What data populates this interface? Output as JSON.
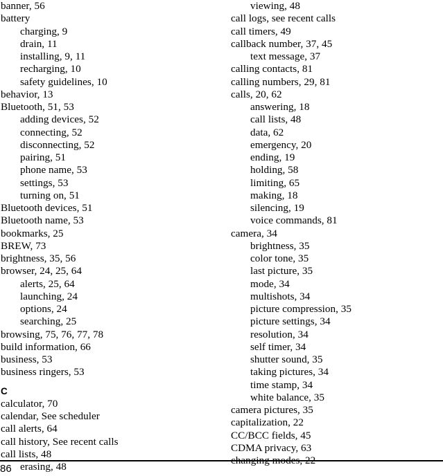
{
  "document": {
    "type": "book-index",
    "page_number": "86",
    "columns": 2,
    "footer_rule": true,
    "text_color": "#000000",
    "background_color": "#ffffff"
  },
  "left_column": [
    {
      "level": 1,
      "text": "banner, 56"
    },
    {
      "level": 1,
      "text": "battery"
    },
    {
      "level": 2,
      "text": "charging, 9"
    },
    {
      "level": 2,
      "text": "drain, 11"
    },
    {
      "level": 2,
      "text": "installing, 9, 11"
    },
    {
      "level": 2,
      "text": "recharging, 10"
    },
    {
      "level": 2,
      "text": "safety guidelines, 10"
    },
    {
      "level": 1,
      "text": "behavior, 13"
    },
    {
      "level": 1,
      "text": "Bluetooth, 51, 53"
    },
    {
      "level": 2,
      "text": "adding devices, 52"
    },
    {
      "level": 2,
      "text": "connecting, 52"
    },
    {
      "level": 2,
      "text": "disconnecting, 52"
    },
    {
      "level": 2,
      "text": "pairing, 51"
    },
    {
      "level": 2,
      "text": "phone name, 53"
    },
    {
      "level": 2,
      "text": "settings, 53"
    },
    {
      "level": 2,
      "text": "turning on, 51"
    },
    {
      "level": 1,
      "text": "Bluetooth devices, 51"
    },
    {
      "level": 1,
      "text": "Bluetooth name, 53"
    },
    {
      "level": 1,
      "text": "bookmarks, 25"
    },
    {
      "level": 1,
      "text": "BREW, 73"
    },
    {
      "level": 1,
      "text": "brightness, 35, 56"
    },
    {
      "level": 1,
      "text": "browser, 24, 25, 64"
    },
    {
      "level": 2,
      "text": "alerts, 25, 64"
    },
    {
      "level": 2,
      "text": "launching, 24"
    },
    {
      "level": 2,
      "text": "options, 24"
    },
    {
      "level": 2,
      "text": "searching, 25"
    },
    {
      "level": 1,
      "text": "browsing, 75, 76, 77, 78"
    },
    {
      "level": 1,
      "text": "build information, 66"
    },
    {
      "level": 1,
      "text": "business, 53"
    },
    {
      "level": 1,
      "text": "business ringers, 53"
    },
    {
      "level": "spacer",
      "text": ""
    },
    {
      "level": "section",
      "text": "C"
    },
    {
      "level": 1,
      "text": "calculator, 70"
    },
    {
      "level": 1,
      "text": "calendar, See scheduler"
    },
    {
      "level": 1,
      "text": "call alerts, 64"
    },
    {
      "level": 1,
      "text": "call history, See recent calls"
    },
    {
      "level": 1,
      "text": "call lists, 48"
    },
    {
      "level": 2,
      "text": "erasing, 48"
    }
  ],
  "right_column": [
    {
      "level": 2,
      "text": "viewing, 48"
    },
    {
      "level": 1,
      "text": "call logs, see recent calls"
    },
    {
      "level": 1,
      "text": "call timers, 49"
    },
    {
      "level": 1,
      "text": "callback number, 37, 45"
    },
    {
      "level": 2,
      "text": "text message, 37"
    },
    {
      "level": 1,
      "text": "calling contacts, 81"
    },
    {
      "level": 1,
      "text": "calling numbers, 29, 81"
    },
    {
      "level": 1,
      "text": "calls, 20, 62"
    },
    {
      "level": 2,
      "text": "answering, 18"
    },
    {
      "level": 2,
      "text": "call lists, 48"
    },
    {
      "level": 2,
      "text": "data, 62"
    },
    {
      "level": 2,
      "text": "emergency, 20"
    },
    {
      "level": 2,
      "text": "ending, 19"
    },
    {
      "level": 2,
      "text": "holding, 58"
    },
    {
      "level": 2,
      "text": "limiting, 65"
    },
    {
      "level": 2,
      "text": "making, 18"
    },
    {
      "level": 2,
      "text": "silencing, 19"
    },
    {
      "level": 2,
      "text": "voice commands, 81"
    },
    {
      "level": 1,
      "text": "camera, 34"
    },
    {
      "level": 2,
      "text": "brightness, 35"
    },
    {
      "level": 2,
      "text": "color tone, 35"
    },
    {
      "level": 2,
      "text": "last picture, 35"
    },
    {
      "level": 2,
      "text": "mode, 34"
    },
    {
      "level": 2,
      "text": "multishots, 34"
    },
    {
      "level": 2,
      "text": "picture compression, 35"
    },
    {
      "level": 2,
      "text": "picture settings, 34"
    },
    {
      "level": 2,
      "text": "resolution, 34"
    },
    {
      "level": 2,
      "text": "self timer, 34"
    },
    {
      "level": 2,
      "text": "shutter sound, 35"
    },
    {
      "level": 2,
      "text": "taking pictures, 34"
    },
    {
      "level": 2,
      "text": "time stamp, 34"
    },
    {
      "level": 2,
      "text": "white balance, 35"
    },
    {
      "level": 1,
      "text": "camera pictures, 35"
    },
    {
      "level": 1,
      "text": "capitalization, 22"
    },
    {
      "level": 1,
      "text": "CC/BCC fields, 45"
    },
    {
      "level": 1,
      "text": "CDMA privacy, 63"
    },
    {
      "level": 1,
      "text": "changing modes, 22"
    }
  ]
}
